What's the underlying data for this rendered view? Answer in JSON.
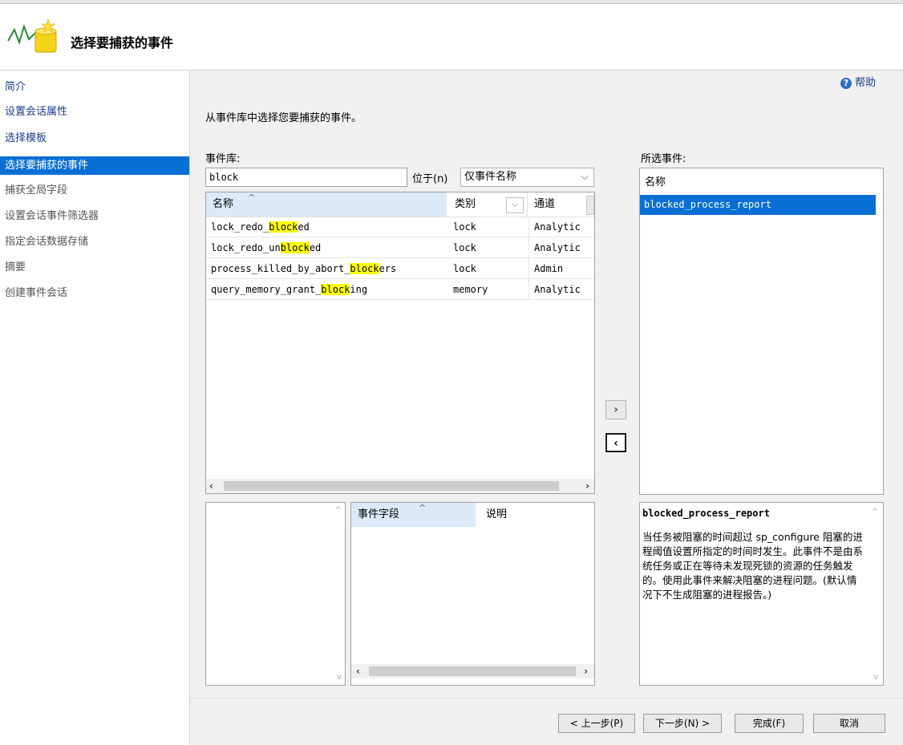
{
  "header": {
    "title": "选择要捕获的事件"
  },
  "sidebar": {
    "items": [
      {
        "label": "简介"
      },
      {
        "label": "设置会话属性"
      },
      {
        "label": "选择模板"
      },
      {
        "label": "选择要捕获的事件"
      },
      {
        "label": "捕获全局字段"
      },
      {
        "label": "设置会话事件筛选器"
      },
      {
        "label": "指定会话数据存储"
      },
      {
        "label": "摘要"
      },
      {
        "label": "创建事件会话"
      }
    ]
  },
  "help": {
    "label": "帮助"
  },
  "instructions": "从事件库中选择您要捕获的事件。",
  "library": {
    "label": "事件库:",
    "search_value": "block",
    "search_in_label": "位于(n)",
    "search_in_value": "仅事件名称",
    "columns": {
      "name": "名称",
      "category": "类别",
      "channel": "通道"
    },
    "rows": [
      {
        "pre": "lock_redo_",
        "hl": "block",
        "post": "ed",
        "category": "lock",
        "channel": "Analytic"
      },
      {
        "pre": "lock_redo_un",
        "hl": "block",
        "post": "ed",
        "category": "lock",
        "channel": "Analytic"
      },
      {
        "pre": "process_killed_by_abort_",
        "hl": "block",
        "post": "ers",
        "category": "lock",
        "channel": "Admin"
      },
      {
        "pre": "query_memory_grant_",
        "hl": "block",
        "post": "ing",
        "category": "memory",
        "channel": "Analytic"
      }
    ]
  },
  "fields": {
    "col_field": "事件字段",
    "col_desc": "说明"
  },
  "selected": {
    "label": "所选事件:",
    "column": "名称",
    "items": [
      "blocked_process_report"
    ]
  },
  "description": {
    "title": "blocked_process_report",
    "text": "当任务被阻塞的时间超过 sp_configure 阻塞的进程阈值设置所指定的时间时发生。此事件不是由系统任务或正在等待未发现死锁的资源的任务触发的。使用此事件来解决阻塞的进程问题。(默认情况下不生成阻塞的进程报告。)"
  },
  "footer": {
    "back": "< 上一步(P)",
    "next": "下一步(N) >",
    "finish": "完成(F)",
    "cancel": "取消"
  },
  "colors": {
    "selection": "#0a6fd4",
    "highlight": "#ffff00",
    "link": "#1a3e8c"
  }
}
